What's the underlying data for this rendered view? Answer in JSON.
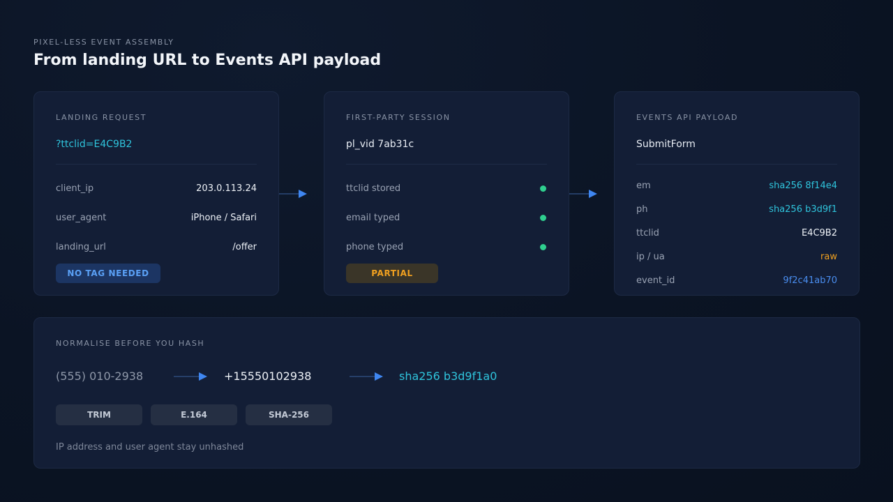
{
  "header": {
    "eyebrow": "PIXEL-LESS EVENT ASSEMBLY",
    "title": "From landing URL to Events API payload"
  },
  "cards": {
    "landing": {
      "label": "LANDING REQUEST",
      "head": "?ttclid=E4C9B2",
      "rows": [
        {
          "key": "client_ip",
          "value": "203.0.113.24"
        },
        {
          "key": "user_agent",
          "value": "iPhone / Safari"
        },
        {
          "key": "landing_url",
          "value": "/offer"
        }
      ],
      "badge": "NO TAG NEEDED"
    },
    "session": {
      "label": "FIRST-PARTY SESSION",
      "head": "pl_vid 7ab31c",
      "rows": [
        {
          "key": "ttclid stored",
          "status": "done"
        },
        {
          "key": "email typed",
          "status": "done"
        },
        {
          "key": "phone typed",
          "status": "done"
        }
      ],
      "badge": "PARTIAL"
    },
    "payload": {
      "label": "EVENTS API PAYLOAD",
      "head": "SubmitForm",
      "rows": [
        {
          "key": "em",
          "value": "sha256 8f14e4"
        },
        {
          "key": "ph",
          "value": "sha256 b3d9f1"
        },
        {
          "key": "ttclid",
          "value": "E4C9B2"
        },
        {
          "key": "ip / ua",
          "value": "raw"
        },
        {
          "key": "event_id",
          "value": "9f2c41ab70"
        }
      ]
    }
  },
  "normalise": {
    "label": "NORMALISE BEFORE YOU HASH",
    "steps": [
      "(555) 010-2938",
      "+15550102938",
      "sha256 b3d9f1a0"
    ],
    "pills": [
      "TRIM",
      "E.164",
      "SHA-256"
    ],
    "note": "IP address and user agent stay unhashed"
  },
  "colors": {
    "accent_cyan": "#2fc4dc",
    "accent_blue": "#4a8ef0",
    "status_green": "#2fcf8f",
    "warning_orange": "#f0a020"
  },
  "icons": {
    "status": "green-dot-icon",
    "flow": "arrow-right-icon"
  }
}
